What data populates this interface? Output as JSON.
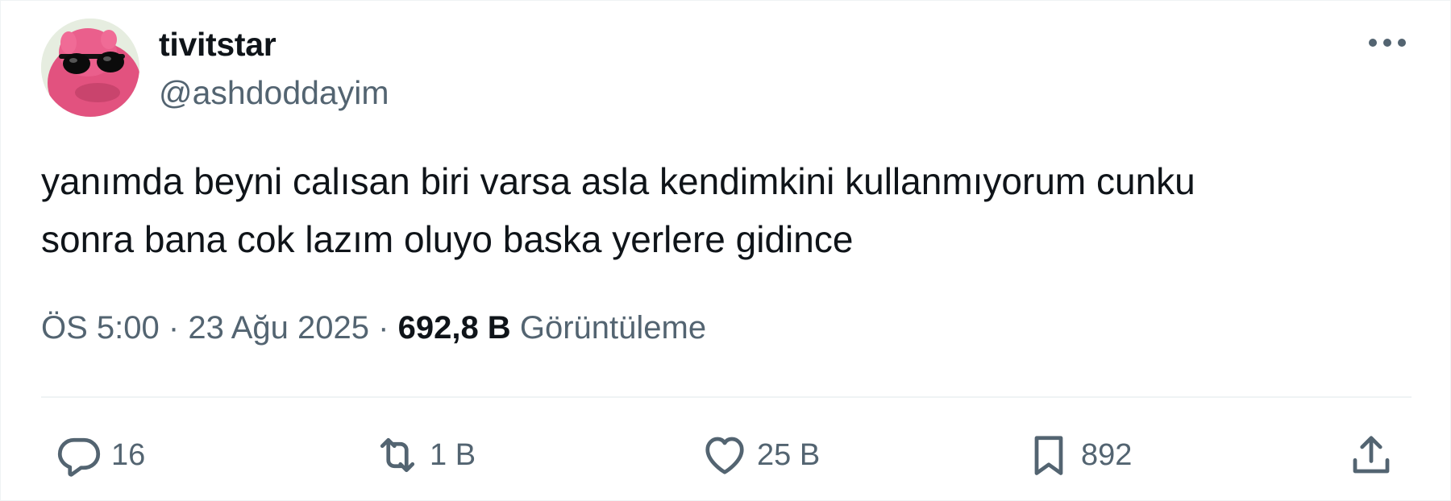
{
  "user": {
    "display_name": "tivitstar",
    "handle": "@ashdoddayim",
    "avatar_icon": "pink-character-with-sunglasses-avatar"
  },
  "tweet": {
    "text_line_1": "yanımda beyni calısan biri varsa asla kendimkini kullanmıyorum cunku",
    "text_line_2": "sonra bana cok lazım oluyo baska yerlere gidince"
  },
  "meta": {
    "time": "ÖS 5:00",
    "separator": "·",
    "date": "23 Ağu 2025",
    "views_count": "692,8 B",
    "views_label": "Görüntüleme"
  },
  "actions": {
    "reply": {
      "icon": "reply-icon",
      "count": "16"
    },
    "retweet": {
      "icon": "retweet-icon",
      "count": "1 B"
    },
    "like": {
      "icon": "heart-icon",
      "count": "25 B"
    },
    "bookmark": {
      "icon": "bookmark-icon",
      "count": "892"
    },
    "share": {
      "icon": "share-icon"
    }
  },
  "colors": {
    "text_primary": "#0f1419",
    "text_secondary": "#536471",
    "divider": "#eff3f4"
  }
}
